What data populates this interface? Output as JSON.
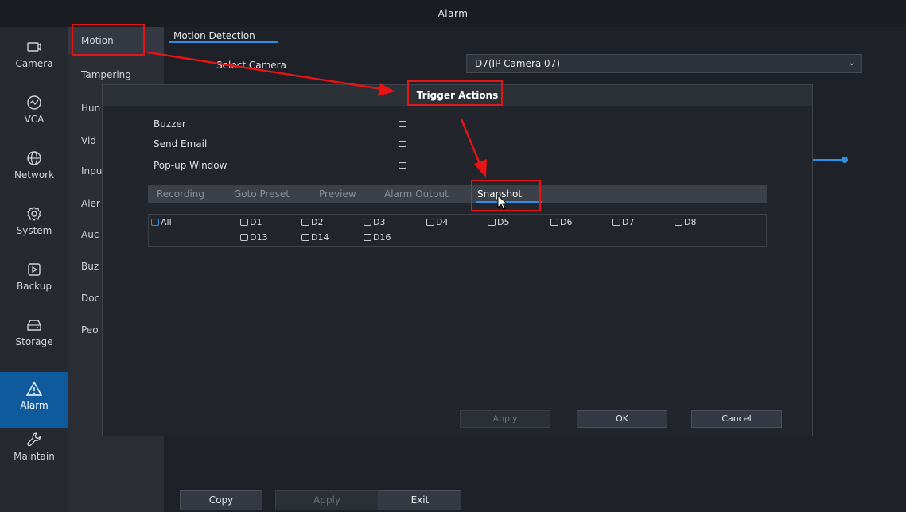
{
  "window": {
    "title": "Alarm"
  },
  "nav": [
    {
      "label": "Camera",
      "icon": "camera-icon"
    },
    {
      "label": "VCA",
      "icon": "vca-icon"
    },
    {
      "label": "Network",
      "icon": "globe-icon"
    },
    {
      "label": "System",
      "icon": "gear-icon"
    },
    {
      "label": "Backup",
      "icon": "backup-icon"
    },
    {
      "label": "Storage",
      "icon": "storage-icon"
    },
    {
      "label": "Alarm",
      "icon": "alarm-icon",
      "active": true
    },
    {
      "label": "Maintain",
      "icon": "wrench-icon"
    }
  ],
  "submenu": [
    "Motion",
    "Tampering",
    "Hun",
    "Vid",
    "Inpu",
    "Aler",
    "Auc",
    "Buz",
    "Doc",
    "Peo"
  ],
  "main": {
    "tab": "Motion Detection",
    "select_camera_label": "Select Camera",
    "select_camera_value": "D7(IP Camera 07)"
  },
  "bottom_buttons": {
    "copy": "Copy",
    "apply": "Apply",
    "exit": "Exit"
  },
  "modal": {
    "title": "Trigger Actions",
    "options": [
      "Buzzer",
      "Send Email",
      "Pop-up Window"
    ],
    "tabs": [
      "Recording",
      "Goto Preset",
      "Preview",
      "Alarm Output",
      "Snapshot"
    ],
    "active_tab": "Snapshot",
    "cameras_row1": [
      "All",
      "D1",
      "D2",
      "D3",
      "D4",
      "D5",
      "D6",
      "D7",
      "D8"
    ],
    "cameras_row2": [
      "D13",
      "D14",
      "D16"
    ],
    "buttons": {
      "apply": "Apply",
      "ok": "OK",
      "cancel": "Cancel"
    }
  },
  "colors": {
    "accent": "#2e8fe8",
    "annotation": "#e61414",
    "active_nav": "#0f5a9c"
  }
}
